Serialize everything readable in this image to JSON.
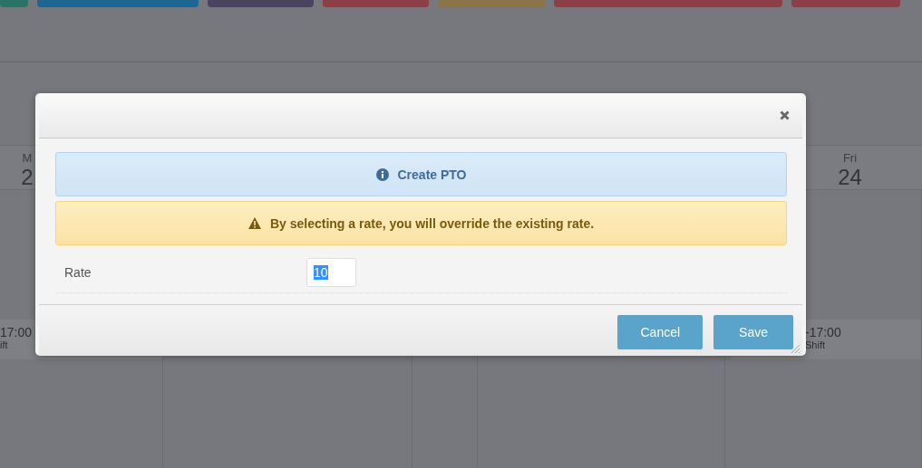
{
  "background": {
    "color_buttons": [
      {
        "color": "#2a7366"
      },
      {
        "color": "#1e6591"
      },
      {
        "color": "#4a4461"
      },
      {
        "color": "#8a4046"
      },
      {
        "color": "#8a7448"
      },
      {
        "color": "#8a4046"
      },
      {
        "color": "#8a4046"
      }
    ],
    "day_headers": [
      {
        "weekday": "M",
        "day": "2"
      },
      {
        "weekday": "Fri",
        "day": "24"
      }
    ],
    "shifts": [
      {
        "time": "17:00",
        "label": "ift"
      },
      {
        "time": "-17:00",
        "label": "Shift"
      }
    ]
  },
  "dialog": {
    "alerts": [
      {
        "kind": "info",
        "text": "Create PTO"
      },
      {
        "kind": "warning",
        "text": "By selecting a rate, you will override the existing rate."
      }
    ],
    "fields": [
      {
        "label": "Rate",
        "value": "10",
        "selected": true
      }
    ],
    "buttons": [
      "Cancel",
      "Save"
    ]
  }
}
